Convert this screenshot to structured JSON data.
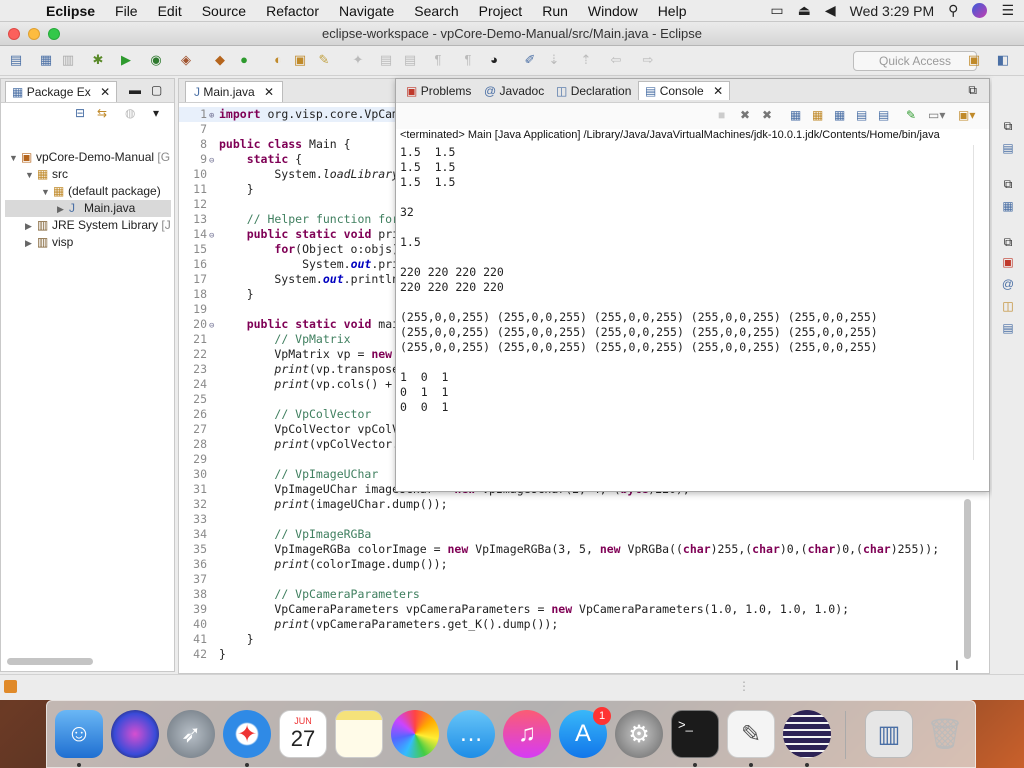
{
  "menubar": {
    "app": "Eclipse",
    "items": [
      "File",
      "Edit",
      "Source",
      "Refactor",
      "Navigate",
      "Search",
      "Project",
      "Run",
      "Window",
      "Help"
    ],
    "clock": "Wed 3:29 PM"
  },
  "window": {
    "title": "eclipse-workspace - vpCore-Demo-Manual/src/Main.java - Eclipse",
    "quick_access_placeholder": "Quick Access"
  },
  "package_explorer": {
    "tab_label": "Package Ex",
    "tree": [
      {
        "label": "vpCore-Demo-Manual",
        "suffix": "[G",
        "icon": "project-icon",
        "level": 0,
        "expanded": true
      },
      {
        "label": "src",
        "suffix": "",
        "icon": "source-folder-icon",
        "level": 1,
        "expanded": true
      },
      {
        "label": "(default package)",
        "suffix": "",
        "icon": "package-icon",
        "level": 2,
        "expanded": true
      },
      {
        "label": "Main.java",
        "suffix": "",
        "icon": "java-file-icon",
        "level": 3,
        "expanded": false,
        "selected": true
      },
      {
        "label": "JRE System Library",
        "suffix": "[J",
        "icon": "library-icon",
        "level": 1,
        "expanded": false
      },
      {
        "label": "visp",
        "suffix": "",
        "icon": "library-icon",
        "level": 1,
        "expanded": false
      }
    ]
  },
  "editor": {
    "tab_label": "Main.java",
    "lines": [
      {
        "n": "1",
        "fold": "+",
        "t": "import org.visp.core.VpCam"
      },
      {
        "n": "7",
        "fold": "",
        "t": ""
      },
      {
        "n": "8",
        "fold": "",
        "t": "public class Main {"
      },
      {
        "n": "9",
        "fold": "-",
        "t": "    static {"
      },
      {
        "n": "10",
        "fold": "",
        "t": "        System.loadLibrary"
      },
      {
        "n": "11",
        "fold": "",
        "t": "    }"
      },
      {
        "n": "12",
        "fold": "",
        "t": ""
      },
      {
        "n": "13",
        "fold": "",
        "t": "    // Helper function for"
      },
      {
        "n": "14",
        "fold": "-",
        "t": "    public static void pri"
      },
      {
        "n": "15",
        "fold": "",
        "t": "        for(Object o:objs)"
      },
      {
        "n": "16",
        "fold": "",
        "t": "            System.out.pri"
      },
      {
        "n": "17",
        "fold": "",
        "t": "        System.out.println"
      },
      {
        "n": "18",
        "fold": "",
        "t": "    }"
      },
      {
        "n": "19",
        "fold": "",
        "t": ""
      },
      {
        "n": "20",
        "fold": "-",
        "t": "    public static void mai"
      },
      {
        "n": "21",
        "fold": "",
        "t": "        // VpMatrix"
      },
      {
        "n": "22",
        "fold": "",
        "t": "        VpMatrix vp = new"
      },
      {
        "n": "23",
        "fold": "",
        "t": "        print(vp.transpose"
      },
      {
        "n": "24",
        "fold": "",
        "t": "        print(vp.cols() +"
      },
      {
        "n": "25",
        "fold": "",
        "t": ""
      },
      {
        "n": "26",
        "fold": "",
        "t": "        // VpColVector"
      },
      {
        "n": "27",
        "fold": "",
        "t": "        VpColVector vpColV"
      },
      {
        "n": "28",
        "fold": "",
        "t": "        print(vpColVector."
      },
      {
        "n": "29",
        "fold": "",
        "t": ""
      },
      {
        "n": "30",
        "fold": "",
        "t": "        // VpImageUChar"
      },
      {
        "n": "31",
        "fold": "",
        "t": "        VpImageUChar imageUChar = new VpImageUChar(2, 4, (byte)220);"
      },
      {
        "n": "32",
        "fold": "",
        "t": "        print(imageUChar.dump());"
      },
      {
        "n": "33",
        "fold": "",
        "t": ""
      },
      {
        "n": "34",
        "fold": "",
        "t": "        // VpImageRGBa"
      },
      {
        "n": "35",
        "fold": "",
        "t": "        VpImageRGBa colorImage = new VpImageRGBa(3, 5, new VpRGBa((char)255,(char)0,(char)0,(char)255));"
      },
      {
        "n": "36",
        "fold": "",
        "t": "        print(colorImage.dump());"
      },
      {
        "n": "37",
        "fold": "",
        "t": ""
      },
      {
        "n": "38",
        "fold": "",
        "t": "        // VpCameraParameters"
      },
      {
        "n": "39",
        "fold": "",
        "t": "        VpCameraParameters vpCameraParameters = new VpCameraParameters(1.0, 1.0, 1.0, 1.0);"
      },
      {
        "n": "40",
        "fold": "",
        "t": "        print(vpCameraParameters.get_K().dump());"
      },
      {
        "n": "41",
        "fold": "",
        "t": "    }"
      },
      {
        "n": "42",
        "fold": "",
        "t": "}"
      }
    ]
  },
  "console_panel": {
    "tabs": [
      {
        "label": "Problems",
        "icon": "problems-icon",
        "active": false
      },
      {
        "label": "Javadoc",
        "icon": "javadoc-icon",
        "active": false
      },
      {
        "label": "Declaration",
        "icon": "declaration-icon",
        "active": false
      },
      {
        "label": "Console",
        "icon": "console-icon",
        "active": true
      }
    ],
    "terminated": "<terminated> Main [Java Application] /Library/Java/JavaVirtualMachines/jdk-10.0.1.jdk/Contents/Home/bin/java",
    "output": [
      "1.5  1.5",
      "1.5  1.5",
      "1.5  1.5",
      "",
      "32",
      "",
      "1.5",
      "",
      "220 220 220 220",
      "220 220 220 220",
      "",
      "(255,0,0,255) (255,0,0,255) (255,0,0,255) (255,0,0,255) (255,0,0,255)",
      "(255,0,0,255) (255,0,0,255) (255,0,0,255) (255,0,0,255) (255,0,0,255)",
      "(255,0,0,255) (255,0,0,255) (255,0,0,255) (255,0,0,255) (255,0,0,255)",
      "",
      "1  0  1",
      "0  1  1",
      "0  0  1"
    ]
  },
  "dock": {
    "calendar_month": "JUN",
    "calendar_day": "27",
    "appstore_badge": "1",
    "terminal_prompt": ">_"
  },
  "colors": {
    "keyword": "#7f0055",
    "comment": "#3f7f5f",
    "field": "#0000c0"
  }
}
